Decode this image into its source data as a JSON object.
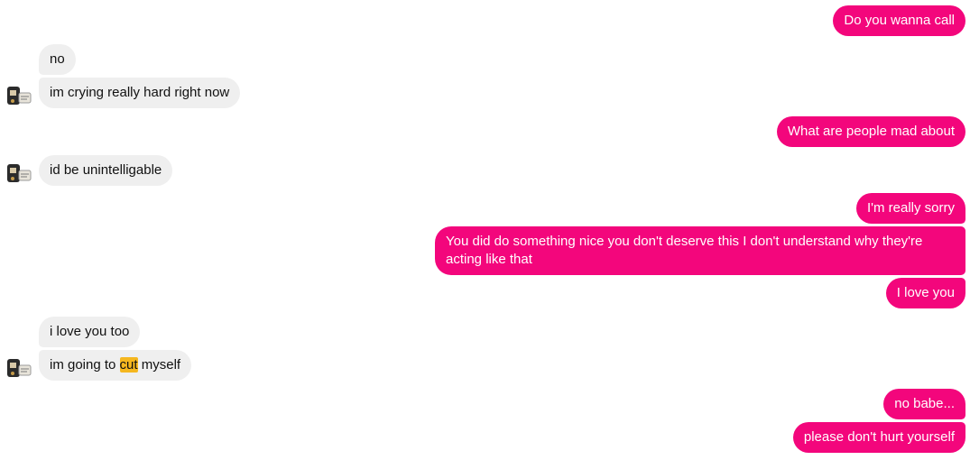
{
  "colors": {
    "sent_bubble": "#f3067c",
    "received_bubble": "#efefef",
    "highlight": "#f5b71f"
  },
  "messages": [
    {
      "from": "me",
      "text": "Do you wanna call"
    },
    {
      "from": "them",
      "text": "no"
    },
    {
      "from": "them",
      "text": "im crying really hard right now"
    },
    {
      "from": "me",
      "text": "What are people mad about"
    },
    {
      "from": "them",
      "text": "id be unintelligable"
    },
    {
      "from": "me",
      "text": "I'm really sorry"
    },
    {
      "from": "me",
      "text": "You did do something nice you don't deserve this I don't understand why they're acting like that"
    },
    {
      "from": "me",
      "text": "I love you"
    },
    {
      "from": "them",
      "text": "i love you too"
    },
    {
      "from": "them",
      "text_before": "im going to ",
      "highlighted": "cut",
      "text_after": " myself"
    },
    {
      "from": "me",
      "text": "no babe..."
    },
    {
      "from": "me",
      "text": "please don't hurt yourself"
    }
  ],
  "avatar_icon": "contact-avatar-icon"
}
